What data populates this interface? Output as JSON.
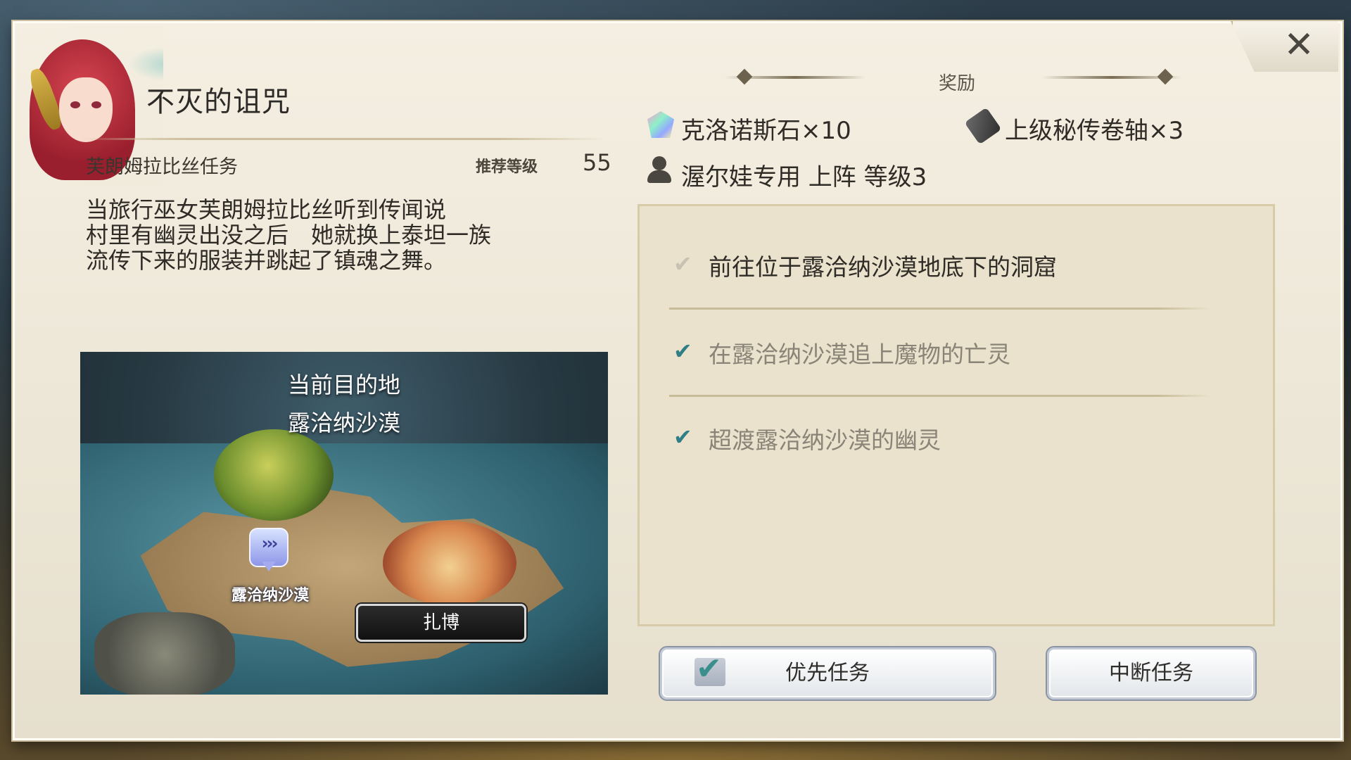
{
  "dialog": {
    "title": "不灭的诅咒",
    "close_icon": "✕",
    "quest_giver": "芙朗姆拉比丝任务",
    "recommended_label": "推荐等级",
    "recommended_level": "55",
    "description_lines": [
      "当旅行巫女芙朗姆拉比丝听到传闻说",
      "村里有幽灵出没之后　她就换上泰坦一族",
      "流传下来的服装并跳起了镇魂之舞。"
    ]
  },
  "map": {
    "heading_line1": "当前目的地",
    "heading_line2": "露洽纳沙漠",
    "pin_glyph": "›››",
    "pin_label": "露洽纳沙漠",
    "location_button": "扎博"
  },
  "rewards": {
    "label": "奖励",
    "items": [
      {
        "icon": "chronos-stone-icon",
        "text": "克洛诺斯石×10"
      },
      {
        "icon": "scroll-icon",
        "text": "上级秘传卷轴×3"
      },
      {
        "icon": "person-icon",
        "text": "渥尔娃专用 上阵 等级3"
      }
    ]
  },
  "objectives": [
    {
      "text": "前往位于露洽纳沙漠地底下的洞窟",
      "status": "current",
      "check_color": "#c9c2b2",
      "text_color": "#2f2b26"
    },
    {
      "text": "在露洽纳沙漠追上魔物的亡灵",
      "status": "pending",
      "check_color": "#2f7f86",
      "text_color": "#8a8478"
    },
    {
      "text": "超渡露洽纳沙漠的幽灵",
      "status": "pending",
      "check_color": "#2f7f86",
      "text_color": "#8a8478"
    }
  ],
  "buttons": {
    "priority": "优先任务",
    "abort": "中断任务"
  },
  "colors": {
    "accent_check": "#3a8f8c",
    "panel_bg": "#f0eadb"
  }
}
